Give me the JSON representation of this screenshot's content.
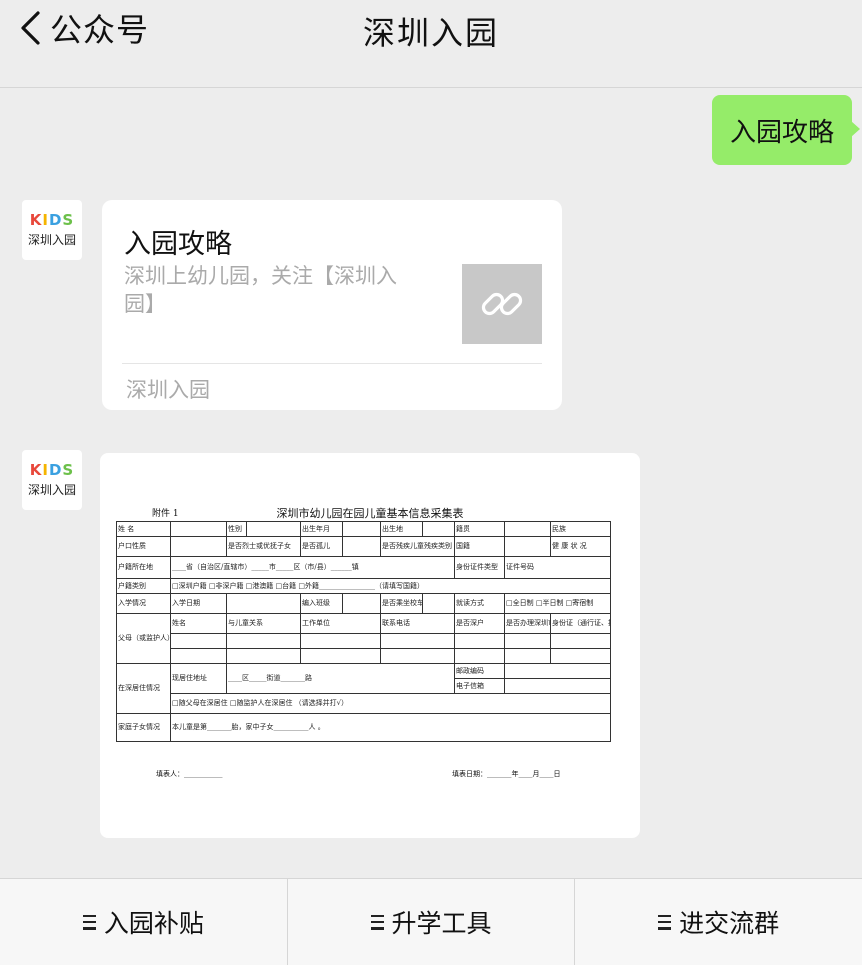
{
  "header": {
    "back_label": "公众号",
    "title": "深圳入园"
  },
  "sent_message": "入园攻略",
  "account": {
    "logo_letters": [
      "K",
      "I",
      "D",
      "S"
    ],
    "name": "深圳入园"
  },
  "link_card": {
    "title": "入园攻略",
    "description": "深圳上幼儿园，关注【深圳入园】",
    "source": "深圳入园",
    "thumb_icon": "link-icon"
  },
  "form_image": {
    "attachment": "附件 1",
    "title": "深圳市幼儿园在园儿童基本信息采集表",
    "row_name": [
      "姓 名",
      "性别",
      "出生年月",
      "出生地",
      "籍贯",
      "民族"
    ],
    "row_hukou": [
      "户口性质",
      "是否烈士或优抚子女",
      "是否孤儿",
      "是否残疾儿童残疾类别",
      "国籍",
      "健 康 状 况"
    ],
    "row_huji_place": [
      "户籍所在地",
      "____省（自治区/直辖市）_____市_____区（市/县）______镇",
      "身份证件类型",
      "证件号码"
    ],
    "row_huji_type": [
      "户籍类别",
      "□深圳户籍 □非深户籍 □港澳籍 □台籍 □外籍________________（请填写国籍）"
    ],
    "row_entry": [
      "入学情况",
      "入学日期",
      "编入班级",
      "是否乘坐校车",
      "就读方式",
      "□全日制 □半日制 □寄宿制"
    ],
    "row_parent": [
      "父母（或监护人）情况",
      "姓名",
      "与儿童关系",
      "工作单位",
      "联系电话",
      "是否深户",
      "是否办理深圳市居住证",
      "身份证（通行证、护照）号码"
    ],
    "row_live": [
      "在深居住情况",
      "现居住地址",
      "____区_____街道_______路",
      "邮政编码",
      "电子信箱",
      "□随父母在深居住 □随监护人在深居住 （请选择并打√）"
    ],
    "row_family": [
      "家庭子女情况",
      "本儿童是第_______胎，家中子女__________人 。"
    ],
    "footer_left": "填表人：___________",
    "footer_right": "填表日期：_______年____月____日"
  },
  "bottom_menu": [
    {
      "label": "入园补贴",
      "icon": "menu-icon"
    },
    {
      "label": "升学工具",
      "icon": "menu-icon"
    },
    {
      "label": "进交流群",
      "icon": "menu-icon"
    }
  ]
}
